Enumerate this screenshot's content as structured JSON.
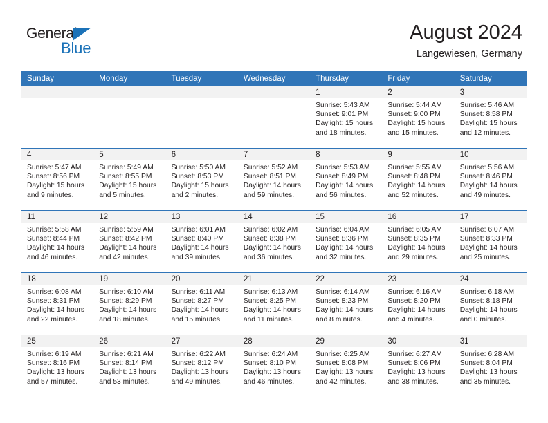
{
  "brand": {
    "name_dark": "General",
    "name_blue": "Blue",
    "accent_color": "#1b72b8"
  },
  "header": {
    "title": "August 2024",
    "subtitle": "Langewiesen, Germany"
  },
  "theme": {
    "header_blue": "#3075b8",
    "daynum_band": "#f2f2f2",
    "text": "#231f20"
  },
  "weekday_headers": [
    "Sunday",
    "Monday",
    "Tuesday",
    "Wednesday",
    "Thursday",
    "Friday",
    "Saturday"
  ],
  "labels": {
    "sunrise_prefix": "Sunrise:",
    "sunset_prefix": "Sunset:",
    "daylight_prefix": "Daylight:"
  },
  "weeks": [
    [
      {
        "day": "",
        "empty": true
      },
      {
        "day": "",
        "empty": true
      },
      {
        "day": "",
        "empty": true
      },
      {
        "day": "",
        "empty": true
      },
      {
        "day": "1",
        "sunrise": "Sunrise: 5:43 AM",
        "sunset": "Sunset: 9:01 PM",
        "daylight_1": "Daylight: 15 hours",
        "daylight_2": "and 18 minutes."
      },
      {
        "day": "2",
        "sunrise": "Sunrise: 5:44 AM",
        "sunset": "Sunset: 9:00 PM",
        "daylight_1": "Daylight: 15 hours",
        "daylight_2": "and 15 minutes."
      },
      {
        "day": "3",
        "sunrise": "Sunrise: 5:46 AM",
        "sunset": "Sunset: 8:58 PM",
        "daylight_1": "Daylight: 15 hours",
        "daylight_2": "and 12 minutes."
      }
    ],
    [
      {
        "day": "4",
        "sunrise": "Sunrise: 5:47 AM",
        "sunset": "Sunset: 8:56 PM",
        "daylight_1": "Daylight: 15 hours",
        "daylight_2": "and 9 minutes."
      },
      {
        "day": "5",
        "sunrise": "Sunrise: 5:49 AM",
        "sunset": "Sunset: 8:55 PM",
        "daylight_1": "Daylight: 15 hours",
        "daylight_2": "and 5 minutes."
      },
      {
        "day": "6",
        "sunrise": "Sunrise: 5:50 AM",
        "sunset": "Sunset: 8:53 PM",
        "daylight_1": "Daylight: 15 hours",
        "daylight_2": "and 2 minutes."
      },
      {
        "day": "7",
        "sunrise": "Sunrise: 5:52 AM",
        "sunset": "Sunset: 8:51 PM",
        "daylight_1": "Daylight: 14 hours",
        "daylight_2": "and 59 minutes."
      },
      {
        "day": "8",
        "sunrise": "Sunrise: 5:53 AM",
        "sunset": "Sunset: 8:49 PM",
        "daylight_1": "Daylight: 14 hours",
        "daylight_2": "and 56 minutes."
      },
      {
        "day": "9",
        "sunrise": "Sunrise: 5:55 AM",
        "sunset": "Sunset: 8:48 PM",
        "daylight_1": "Daylight: 14 hours",
        "daylight_2": "and 52 minutes."
      },
      {
        "day": "10",
        "sunrise": "Sunrise: 5:56 AM",
        "sunset": "Sunset: 8:46 PM",
        "daylight_1": "Daylight: 14 hours",
        "daylight_2": "and 49 minutes."
      }
    ],
    [
      {
        "day": "11",
        "sunrise": "Sunrise: 5:58 AM",
        "sunset": "Sunset: 8:44 PM",
        "daylight_1": "Daylight: 14 hours",
        "daylight_2": "and 46 minutes."
      },
      {
        "day": "12",
        "sunrise": "Sunrise: 5:59 AM",
        "sunset": "Sunset: 8:42 PM",
        "daylight_1": "Daylight: 14 hours",
        "daylight_2": "and 42 minutes."
      },
      {
        "day": "13",
        "sunrise": "Sunrise: 6:01 AM",
        "sunset": "Sunset: 8:40 PM",
        "daylight_1": "Daylight: 14 hours",
        "daylight_2": "and 39 minutes."
      },
      {
        "day": "14",
        "sunrise": "Sunrise: 6:02 AM",
        "sunset": "Sunset: 8:38 PM",
        "daylight_1": "Daylight: 14 hours",
        "daylight_2": "and 36 minutes."
      },
      {
        "day": "15",
        "sunrise": "Sunrise: 6:04 AM",
        "sunset": "Sunset: 8:36 PM",
        "daylight_1": "Daylight: 14 hours",
        "daylight_2": "and 32 minutes."
      },
      {
        "day": "16",
        "sunrise": "Sunrise: 6:05 AM",
        "sunset": "Sunset: 8:35 PM",
        "daylight_1": "Daylight: 14 hours",
        "daylight_2": "and 29 minutes."
      },
      {
        "day": "17",
        "sunrise": "Sunrise: 6:07 AM",
        "sunset": "Sunset: 8:33 PM",
        "daylight_1": "Daylight: 14 hours",
        "daylight_2": "and 25 minutes."
      }
    ],
    [
      {
        "day": "18",
        "sunrise": "Sunrise: 6:08 AM",
        "sunset": "Sunset: 8:31 PM",
        "daylight_1": "Daylight: 14 hours",
        "daylight_2": "and 22 minutes."
      },
      {
        "day": "19",
        "sunrise": "Sunrise: 6:10 AM",
        "sunset": "Sunset: 8:29 PM",
        "daylight_1": "Daylight: 14 hours",
        "daylight_2": "and 18 minutes."
      },
      {
        "day": "20",
        "sunrise": "Sunrise: 6:11 AM",
        "sunset": "Sunset: 8:27 PM",
        "daylight_1": "Daylight: 14 hours",
        "daylight_2": "and 15 minutes."
      },
      {
        "day": "21",
        "sunrise": "Sunrise: 6:13 AM",
        "sunset": "Sunset: 8:25 PM",
        "daylight_1": "Daylight: 14 hours",
        "daylight_2": "and 11 minutes."
      },
      {
        "day": "22",
        "sunrise": "Sunrise: 6:14 AM",
        "sunset": "Sunset: 8:23 PM",
        "daylight_1": "Daylight: 14 hours",
        "daylight_2": "and 8 minutes."
      },
      {
        "day": "23",
        "sunrise": "Sunrise: 6:16 AM",
        "sunset": "Sunset: 8:20 PM",
        "daylight_1": "Daylight: 14 hours",
        "daylight_2": "and 4 minutes."
      },
      {
        "day": "24",
        "sunrise": "Sunrise: 6:18 AM",
        "sunset": "Sunset: 8:18 PM",
        "daylight_1": "Daylight: 14 hours",
        "daylight_2": "and 0 minutes."
      }
    ],
    [
      {
        "day": "25",
        "sunrise": "Sunrise: 6:19 AM",
        "sunset": "Sunset: 8:16 PM",
        "daylight_1": "Daylight: 13 hours",
        "daylight_2": "and 57 minutes."
      },
      {
        "day": "26",
        "sunrise": "Sunrise: 6:21 AM",
        "sunset": "Sunset: 8:14 PM",
        "daylight_1": "Daylight: 13 hours",
        "daylight_2": "and 53 minutes."
      },
      {
        "day": "27",
        "sunrise": "Sunrise: 6:22 AM",
        "sunset": "Sunset: 8:12 PM",
        "daylight_1": "Daylight: 13 hours",
        "daylight_2": "and 49 minutes."
      },
      {
        "day": "28",
        "sunrise": "Sunrise: 6:24 AM",
        "sunset": "Sunset: 8:10 PM",
        "daylight_1": "Daylight: 13 hours",
        "daylight_2": "and 46 minutes."
      },
      {
        "day": "29",
        "sunrise": "Sunrise: 6:25 AM",
        "sunset": "Sunset: 8:08 PM",
        "daylight_1": "Daylight: 13 hours",
        "daylight_2": "and 42 minutes."
      },
      {
        "day": "30",
        "sunrise": "Sunrise: 6:27 AM",
        "sunset": "Sunset: 8:06 PM",
        "daylight_1": "Daylight: 13 hours",
        "daylight_2": "and 38 minutes."
      },
      {
        "day": "31",
        "sunrise": "Sunrise: 6:28 AM",
        "sunset": "Sunset: 8:04 PM",
        "daylight_1": "Daylight: 13 hours",
        "daylight_2": "and 35 minutes."
      }
    ]
  ]
}
